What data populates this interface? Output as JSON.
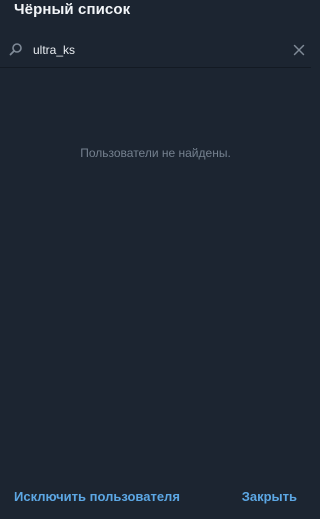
{
  "dialog": {
    "title": "Чёрный список"
  },
  "search": {
    "value": "ultra_ks",
    "placeholder": ""
  },
  "results": {
    "empty_message": "Пользователи не найдены."
  },
  "footer": {
    "remove_user_label": "Исключить пользователя",
    "close_label": "Закрыть"
  },
  "colors": {
    "background": "#1c2531",
    "accent": "#5ca7e4",
    "muted_text": "#75818f",
    "title_text": "#f2f5f8"
  },
  "icons": {
    "search": "search-icon",
    "clear": "close-icon"
  }
}
